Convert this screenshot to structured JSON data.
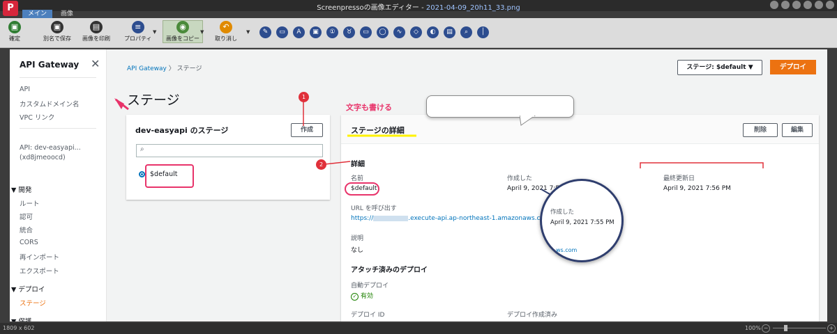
{
  "app": {
    "logo": "P",
    "title": "Screenpressoの画像エディター",
    "separator": " - ",
    "file": "2021-04-09_20h11_33.png",
    "tabs": [
      "メイン",
      "画像"
    ]
  },
  "ribbon": {
    "buttons": [
      {
        "label": "確定",
        "icon": "save-icon",
        "glyph": "▣",
        "color": "#2f7d32"
      },
      {
        "label": "別名で保存",
        "icon": "save-as-icon",
        "glyph": "▣",
        "color": "#333333"
      },
      {
        "label": "画像を印刷",
        "icon": "print-icon",
        "glyph": "▤",
        "color": "#333333"
      },
      {
        "label": "プロパティ",
        "icon": "properties-icon",
        "glyph": "≡",
        "color": "#2d4d8f"
      },
      {
        "label": "画像をコピー",
        "icon": "copy-icon",
        "glyph": "◉",
        "color": "#4a8a3a"
      },
      {
        "label": "取り消し",
        "icon": "undo-icon",
        "glyph": "↶",
        "color": "#e08a00"
      }
    ],
    "tools": [
      "✎",
      "▭",
      "A",
      "▣",
      "①",
      "♉",
      "▭",
      "◯",
      "∿",
      "◇",
      "◐",
      "▤",
      "⌕",
      "│"
    ]
  },
  "status": {
    "size": "1809 x 602",
    "zoom": "100%"
  },
  "sidebar": {
    "title": "API Gateway",
    "items_top": [
      "API",
      "カスタムドメイン名",
      "VPC リンク"
    ],
    "api_name": "API: dev-easyapi...",
    "api_id": "(xd8jmeoocd)",
    "section_dev": "開発",
    "dev_items": [
      "ルート",
      "認可",
      "統合",
      "CORS",
      "再インポート",
      "エクスポート"
    ],
    "section_deploy": "デプロイ",
    "deploy_active": "ステージ",
    "section_protect": "保護"
  },
  "breadcrumb": {
    "root": "API Gateway",
    "sep": "〉",
    "current": "ステージ"
  },
  "header": {
    "stage_select": "ステージ: $default",
    "deploy": "デプロイ"
  },
  "page": {
    "title": "ステージ"
  },
  "stages_panel": {
    "title": "dev-easyapi のステージ",
    "create": "作成",
    "search_placeholder": "",
    "stage": "$default"
  },
  "detail_panel": {
    "title": "ステージの詳細",
    "delete": "削除",
    "edit": "編集",
    "section_details": "詳細",
    "name_label": "名前",
    "name_value": "$default",
    "created_label": "作成した",
    "created_value": "April 9, 2021 7:5",
    "updated_label": "最終更新日",
    "updated_value": "April 9, 2021 7:56 PM",
    "url_label": "URL を呼び出す",
    "url_prefix": "https://",
    "url_suffix": ".execute-api.ap-northeast-1.amazonaws.com",
    "desc_label": "説明",
    "desc_value": "なし",
    "attached_title": "アタッチ済みのデプロイ",
    "auto_label": "自動デプロイ",
    "auto_value": "有効",
    "deploy_id_label": "デプロイ ID",
    "deploy_created_label": "デプロイ作成済み"
  },
  "annotations": {
    "text": "文字も書ける",
    "n1": "1",
    "n2": "2",
    "magnifier": {
      "label": "作成した",
      "value": "April 9, 2021 7:55 PM",
      "link": "ws.com"
    }
  }
}
